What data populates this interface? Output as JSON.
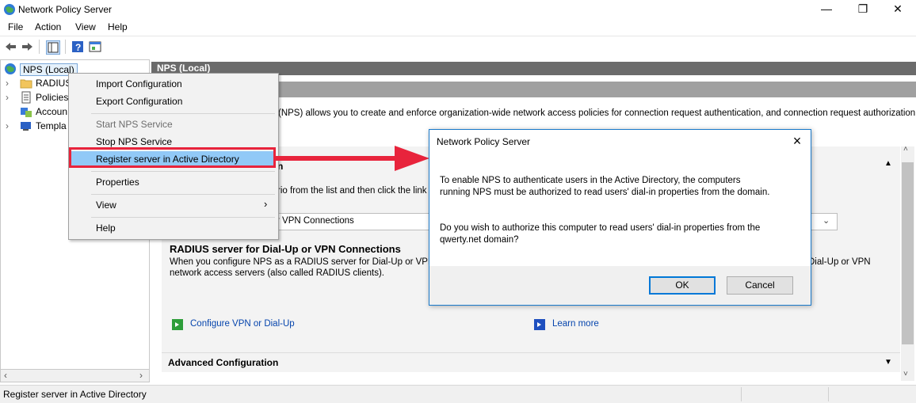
{
  "window": {
    "title": "Network Policy Server",
    "controls": [
      "—",
      "❐",
      "✕"
    ]
  },
  "menu": [
    "File",
    "Action",
    "View",
    "Help"
  ],
  "tree": {
    "root": "NPS (Local)",
    "items": [
      "RADIUS",
      "Policies",
      "Accoun",
      "Templa"
    ]
  },
  "pane": {
    "header": "NPS (Local)",
    "intro": "(NPS) allows you to enforce organization-wide network access policies for connection request authentication, and connection request authorization.",
    "intro_full": "(NPS) allows you to create and enforce organization-wide network access policies for connection request authentication, and connection request authorization.",
    "section_title_frag": "n",
    "select_text_frag": "rio from the list and then click the link belo",
    "dropdown_value_frag": "r VPN Connections",
    "radius_title": "RADIUS server for Dial-Up or VPN Connections",
    "radius_desc1": "When you configure NPS as a RADIUS server for Dial-Up or VPN con",
    "radius_desc1_tail": "Dial-Up or VPN",
    "radius_desc2": "network access servers (also called RADIUS clients).",
    "link_configure": "Configure VPN or Dial-Up",
    "link_learn": "Learn more",
    "advanced": "Advanced Configuration"
  },
  "context_menu": {
    "items": [
      {
        "label": "Import Configuration",
        "enabled": true
      },
      {
        "label": "Export Configuration",
        "enabled": true
      },
      {
        "label": "Start NPS Service",
        "enabled": false
      },
      {
        "label": "Stop NPS Service",
        "enabled": true
      },
      {
        "label": "Register server in Active Directory",
        "enabled": true,
        "highlighted": true
      },
      {
        "label": "Properties",
        "enabled": true
      },
      {
        "label": "View",
        "enabled": true,
        "submenu": true
      },
      {
        "label": "Help",
        "enabled": true
      }
    ]
  },
  "dialog": {
    "title": "Network Policy Server",
    "message1": "To enable NPS to authenticate users in the Active Directory, the computers running NPS must be authorized to read users' dial-in properties from the domain.",
    "message2": "Do you wish to authorize this computer to read users' dial-in  properties from the qwerty.net domain?",
    "ok": "OK",
    "cancel": "Cancel"
  },
  "status": "Register server in Active Directory",
  "colors": {
    "annotation_red": "#e8243c",
    "highlight_blue": "#91c9f7",
    "dialog_border": "#1979ca",
    "pane_header": "#6b6b6b"
  }
}
